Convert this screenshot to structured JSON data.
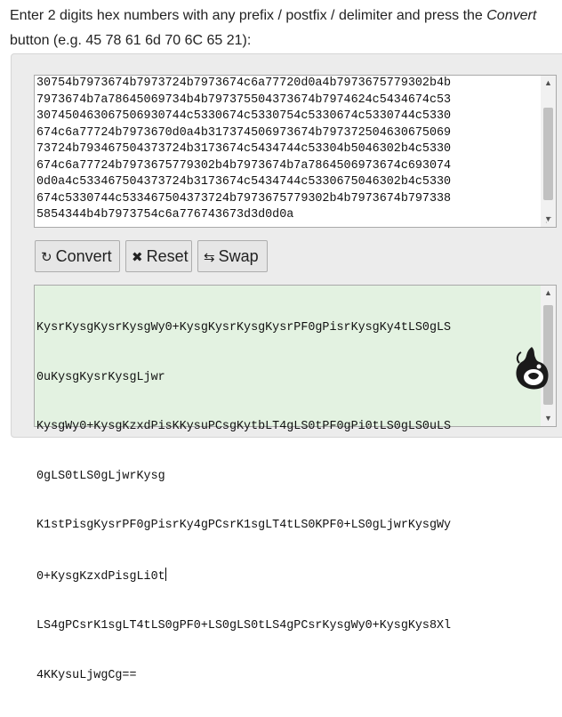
{
  "instructions": {
    "line1_prefix": "Enter 2 digits hex numbers with any prefix / postfix / delimiter and press the ",
    "line1_emphasis": "Convert",
    "line2": "button (e.g. 45 78 61 6d 70 6C 65 21):"
  },
  "input_text": "30754b7973674b7973724b7973674c6a77720d0a4b7973675779302b4b\n7973674b7a78645069734b4b797375504373674b7974624c5434674c53\n307450463067506930744c5330674c5330754c5330674c5330744c5330\n674c6a77724b7973670d0a4b317374506973674b797372504630675069\n73724b793467504373724b3173674c5434744c53304b5046302b4c5330\n674c6a77724b7973675779302b4b7973674b7a7864506973674c693074\n0d0a4c533467504373724b3173674c5434744c5330675046302b4c5330\n674c5330744c533467504373724b7973675779302b4b7973674b797338\n5854344b4b7973754c6a776743673d3d0d0a",
  "buttons": {
    "convert": "Convert",
    "reset": "Reset",
    "swap": "Swap"
  },
  "output_lines": [
    "KysrKysgKysrKysgWy0+KysgKysrKysgKysrPF0gPisrKysgKy4tLS0gLS",
    "0uKysgKysrKysgLjwr",
    "KysgWy0+KysgKzxdPisKKysuPCsgKytbLT4gLS0tPF0gPi0tLS0gLS0uLS",
    "0gLS0tLS0gLjwrKysg",
    "K1stPisgKysrPF0gPisrKy4gPCsrK1sgLT4tLS0KPF0+LS0gLjwrKysgWy",
    "0+KysgKzxdPisgLi0t",
    "LS4gPCsrK1sgLT4tLS0gPF0+LS0gLS0tLS4gPCsrKysgWy0+KysgKys8Xl",
    "4KKysuLjwgCg=="
  ],
  "icons": {
    "convert": "refresh-icon",
    "reset": "close-icon",
    "swap": "swap-icon",
    "logo": "site-logo-icon"
  }
}
